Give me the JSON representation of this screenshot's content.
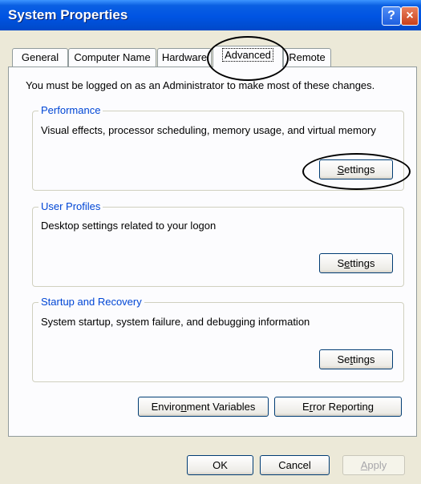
{
  "window": {
    "title": "System Properties",
    "help_glyph": "?",
    "close_glyph": "×"
  },
  "tabs": [
    {
      "label": "General"
    },
    {
      "label": "Computer Name"
    },
    {
      "label": "Hardware"
    },
    {
      "label": "Advanced",
      "active": true
    },
    {
      "label": "Remote"
    }
  ],
  "intro_text": "You must be logged on as an Administrator to make most of these changes.",
  "groups": {
    "performance": {
      "legend": "Performance",
      "description": "Visual effects, processor scheduling, memory usage, and virtual memory",
      "button": {
        "pre": "",
        "key": "S",
        "post": "ettings"
      }
    },
    "user_profiles": {
      "legend": "User Profiles",
      "description": "Desktop settings related to your logon",
      "button": {
        "pre": "S",
        "key": "e",
        "post": "ttings"
      }
    },
    "startup_recovery": {
      "legend": "Startup and Recovery",
      "description": "System startup, system failure, and debugging information",
      "button": {
        "pre": "Se",
        "key": "t",
        "post": "tings"
      }
    }
  },
  "env_button": {
    "pre": "Enviro",
    "key": "n",
    "post": "ment Variables"
  },
  "error_button": {
    "pre": "E",
    "key": "r",
    "post": "ror Reporting"
  },
  "footer": {
    "ok": "OK",
    "cancel": "Cancel",
    "apply": {
      "key": "A",
      "post": "pply"
    }
  },
  "colors": {
    "titlebar": "#0054E3",
    "legend": "#0046D5",
    "dialog_bg": "#ECE9D8"
  }
}
